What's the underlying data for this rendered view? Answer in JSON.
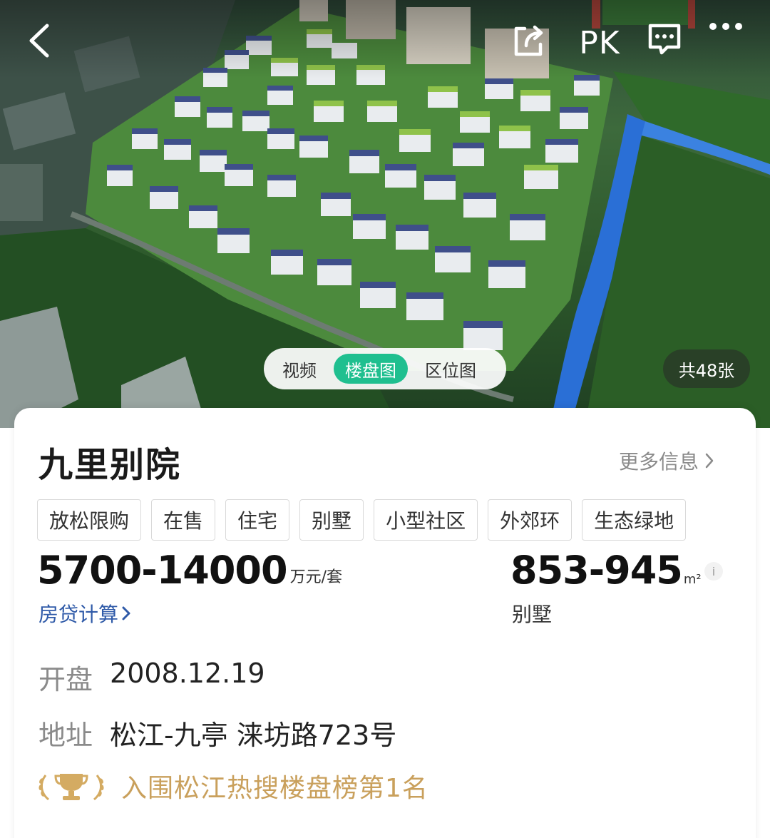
{
  "header": {
    "back_icon": "chevron-left-icon",
    "share_icon": "share-icon",
    "pk_label": "PK",
    "message_icon": "message-icon",
    "more_icon": "more-dots-icon"
  },
  "gallery": {
    "tabs": [
      {
        "label": "视频",
        "active": false
      },
      {
        "label": "楼盘图",
        "active": true
      },
      {
        "label": "区位图",
        "active": false
      }
    ],
    "count_label": "共48张",
    "active_color": "#1fbf8f"
  },
  "property": {
    "name": "九里别院",
    "more_info_label": "更多信息",
    "tags": [
      "放松限购",
      "在售",
      "住宅",
      "别墅",
      "小型社区",
      "外郊环",
      "生态绿地"
    ],
    "price": "5700-14000",
    "price_unit": "万元/套",
    "loan_calc_label": "房贷计算",
    "area": "853-945",
    "area_unit": "m²",
    "area_type": "别墅",
    "open_label": "开盘",
    "open_value": "2008.12.19",
    "address_label": "地址",
    "address_value": "松江-九亭 涞坊路723号",
    "rank_text": "入围松江热搜楼盘榜第1名",
    "rank_color": "#c9a05c",
    "link_color": "#2f5aa8"
  }
}
